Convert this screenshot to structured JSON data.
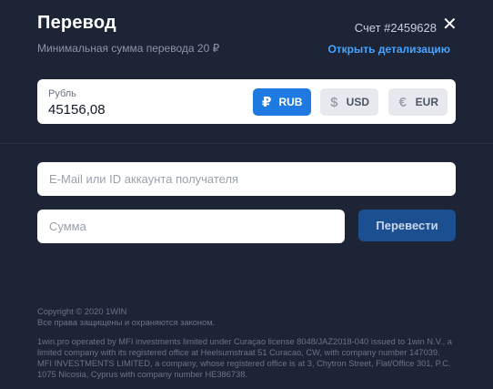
{
  "header": {
    "title": "Перевод",
    "account": "Счет #2459628",
    "close_symbol": "✕"
  },
  "subtitle": "Минимальная сумма перевода 20 ₽",
  "details_link": "Открыть детализацию",
  "balance": {
    "label": "Рубль",
    "value": "45156,08"
  },
  "currencies": [
    {
      "code": "RUB",
      "symbol": "₽",
      "icon": "ruble-icon",
      "selected": true
    },
    {
      "code": "USD",
      "symbol": "$",
      "icon": "dollar-icon",
      "selected": false
    },
    {
      "code": "EUR",
      "symbol": "€",
      "icon": "euro-icon",
      "selected": false
    }
  ],
  "form": {
    "email_placeholder": "E-Mail или ID аккаунта получателя",
    "amount_placeholder": "Сумма",
    "submit_label": "Перевести"
  },
  "footer": {
    "copyright": "Copyright © 2020 1WIN",
    "rights": "Все права защищены и охраняются законом.",
    "legal": "1win.pro operated by MFI investments limited under Curaçao license 8048/JAZ2018-040 issued to 1win N.V., a limited company with its registered office at Heelsumstraat 51 Curacao, CW, with company number 147039. MFI INVESTMENTS LIMITED, a company, whose registered office is at 3, Chytron Street, Flat/Office 301, P.C. 1075 Nicosia, Cyprus with company number HE386738."
  },
  "colors": {
    "background": "#1c2435",
    "accent": "#1e7ae0",
    "link": "#4aa3ff",
    "submit_bg": "#1b4f8f"
  }
}
